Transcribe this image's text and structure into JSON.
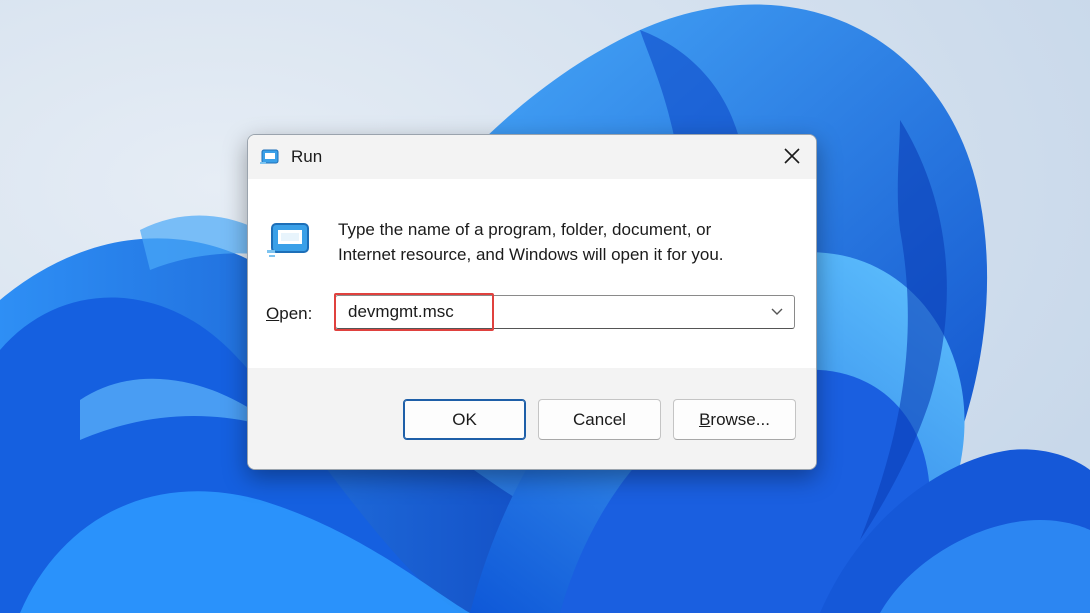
{
  "dialog": {
    "title": "Run",
    "description_line1": "Type the name of a program, folder, document, or",
    "description_line2": "Internet resource, and Windows will open it for you.",
    "open_label_access": "O",
    "open_label_rest": "pen:",
    "open_value": "devmgmt.msc",
    "buttons": {
      "ok": "OK",
      "cancel": "Cancel",
      "browse_access": "B",
      "browse_rest": "rowse..."
    }
  },
  "icons": {
    "title": "run-icon",
    "content": "run-icon",
    "close": "close-icon",
    "dropdown": "chevron-down-icon"
  },
  "colors": {
    "highlight": "#e0413e",
    "accent": "#1e5fa8",
    "wallpaper_blue": "#1a6fe0"
  }
}
